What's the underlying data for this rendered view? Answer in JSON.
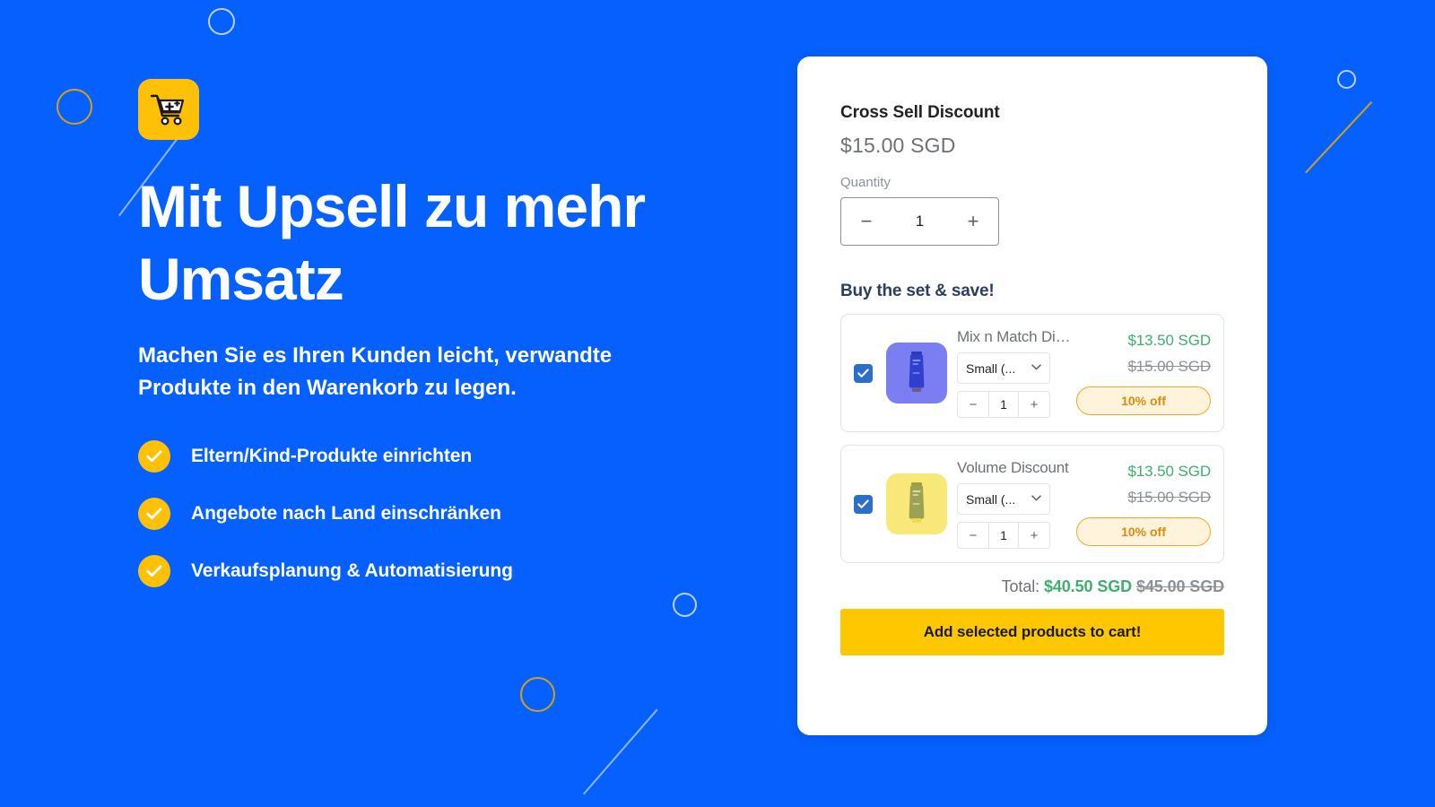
{
  "theme": {
    "background": "#0560fd",
    "accent_yellow": "#ffc107",
    "cta_yellow": "#ffc700",
    "price_green": "#3dae6f",
    "badge_orange": "#d98b0b",
    "checkbox_blue": "#2c6ecb"
  },
  "hero": {
    "logo_icon": "shopping-cart-plus-icon",
    "headline": "Mit Upsell zu mehr Umsatz",
    "subhead": "Machen Sie es Ihren Kunden leicht, verwandte Produkte in den Warenkorb zu legen.",
    "features": [
      {
        "icon": "check-circle-icon",
        "label": "Eltern/Kind-Produkte einrichten"
      },
      {
        "icon": "check-circle-icon",
        "label": "Angebote nach Land einschränken"
      },
      {
        "icon": "check-circle-icon",
        "label": "Verkaufsplanung & Automatisierung"
      }
    ]
  },
  "widget": {
    "product_title": "Cross Sell Discount",
    "product_price": "$15.00 SGD",
    "quantity_label": "Quantity",
    "quantity": {
      "decrement": "−",
      "value": "1",
      "increment": "+"
    },
    "set_title": "Buy the set & save!",
    "offers": [
      {
        "checked": true,
        "thumb_color": "purple",
        "thumb_icon": "product-tube-icon",
        "name": "Mix n Match Dis...",
        "variant": "Small (...",
        "variant_chevron": "chevron-down-icon",
        "qty_decrement": "−",
        "qty_value": "1",
        "qty_increment": "+",
        "price_new": "$13.50 SGD",
        "price_old": "$15.00 SGD",
        "badge": "10% off"
      },
      {
        "checked": true,
        "thumb_color": "yellow",
        "thumb_icon": "product-tube-icon",
        "name": "Volume Discount",
        "variant": "Small (...",
        "variant_chevron": "chevron-down-icon",
        "qty_decrement": "−",
        "qty_value": "1",
        "qty_increment": "+",
        "price_new": "$13.50 SGD",
        "price_old": "$15.00 SGD",
        "badge": "10% off"
      }
    ],
    "total_label": "Total:",
    "total_new": "$40.50 SGD",
    "total_old": "$45.00 SGD",
    "cta_label": "Add selected products to cart!"
  },
  "decorations": {
    "rings": [
      "ring-white",
      "ring-gold",
      "ring-white",
      "ring-white",
      "ring-gold"
    ],
    "lines": [
      "line-white",
      "line-gold",
      "line-white"
    ]
  }
}
